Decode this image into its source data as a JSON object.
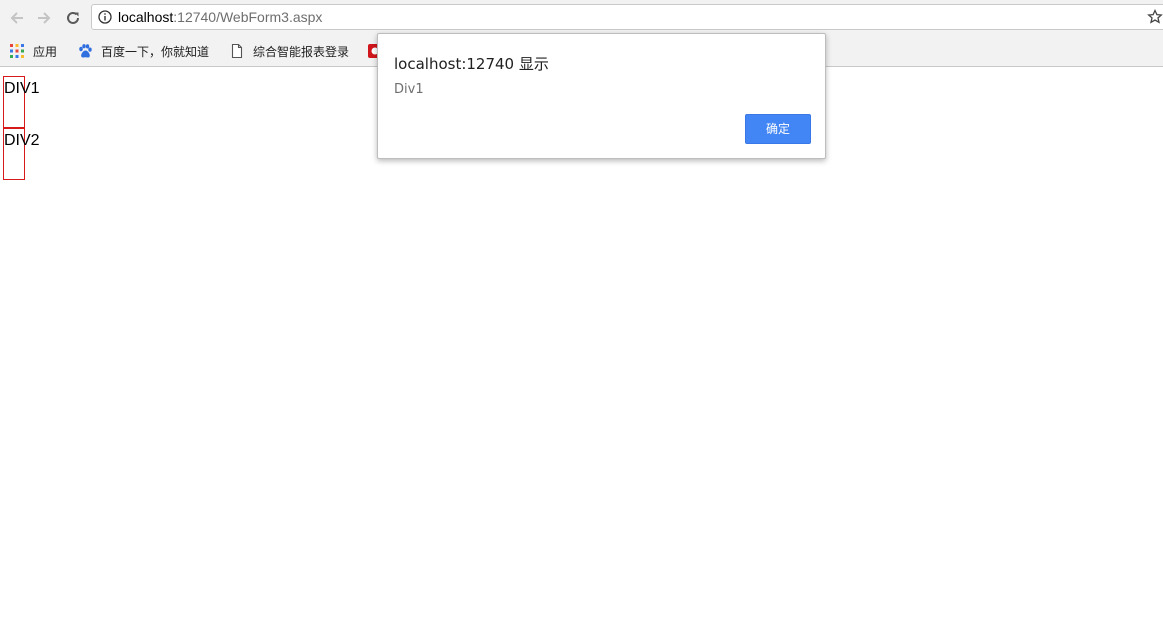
{
  "browser": {
    "url": {
      "host": "localhost",
      "rest": ":12740/WebForm3.aspx"
    },
    "bookmarks": [
      {
        "label": "应用",
        "icon": "apps-grid-icon"
      },
      {
        "label": "百度一下，你就知道",
        "icon": "baidu-paw-icon"
      },
      {
        "label": "综合智能报表登录",
        "icon": "page-icon"
      },
      {
        "label": "",
        "icon": "red-circle-icon"
      }
    ]
  },
  "page": {
    "div1": "DIV1",
    "div2": "DIV2",
    "box_border_color": "#d61a1a"
  },
  "dialog": {
    "title": "localhost:12740 显示",
    "message": "Div1",
    "ok_label": "确定",
    "ok_color": "#4285f4"
  }
}
